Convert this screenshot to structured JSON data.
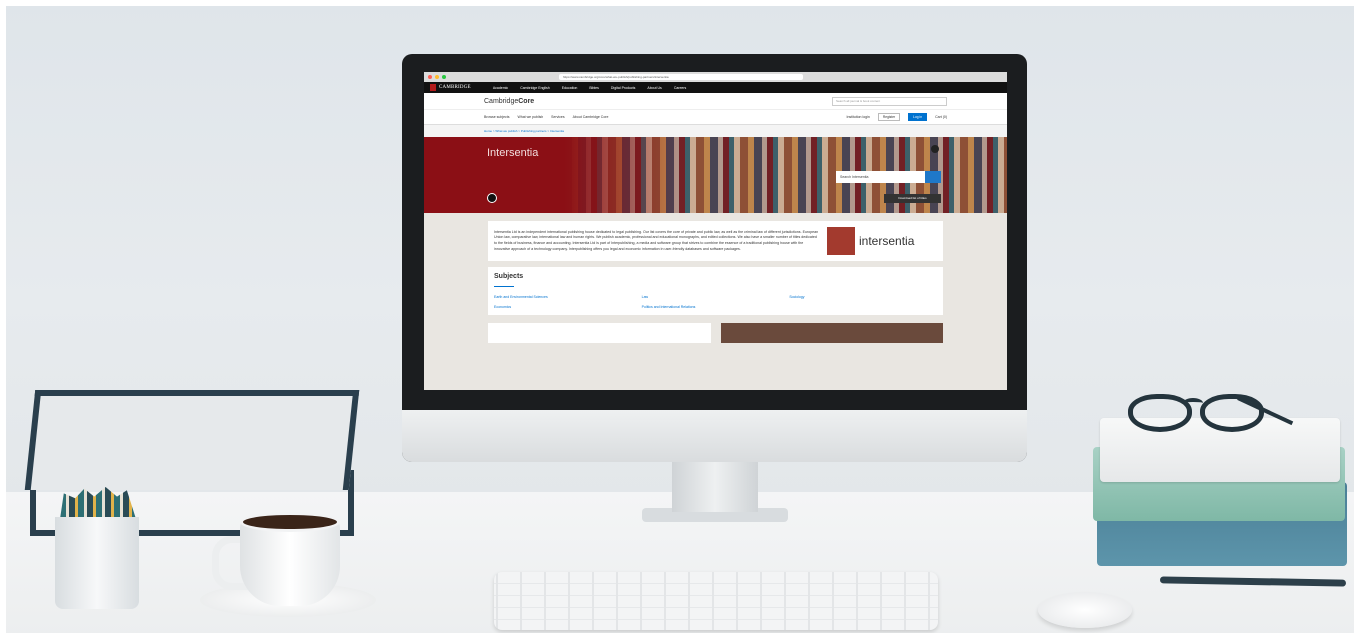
{
  "browser": {
    "url": "https://www.cambridge.org/core/what-we-publish/publishing-partners/intersentia"
  },
  "cup_header": {
    "logo_text": "CAMBRIDGE",
    "logo_sub": "UNIVERSITY PRESS",
    "items": [
      "Academic",
      "Cambridge English",
      "Education",
      "Bibles",
      "Digital Products",
      "About Us",
      "Careers"
    ]
  },
  "core_header": {
    "logo_light": "Cambridge",
    "logo_bold": "Core",
    "search_placeholder": "Search all journal & book content"
  },
  "nav": {
    "items": [
      "Browse subjects",
      "What we publish",
      "Services",
      "About Cambridge Core"
    ],
    "institution_login": "Institution login",
    "register": "Register",
    "login": "Log in",
    "cart": "Cart (0)"
  },
  "breadcrumb": "Home  >  What we publish  >  Publishing partners  >  Intersentia",
  "hero": {
    "title": "Intersentia",
    "search_placeholder": "Search Intersentia",
    "download_label": "Download list of titles"
  },
  "about": {
    "text": "Intersentia Ltd is an independent international publishing house dedicated to legal publishing. Our list covers the core of private and public law, as well as the criminal law of different jurisdictions. European Union law, comparative law, international law and human rights. We publish academic, professional and educational monographs, and edited collections. We also have a smaller number of titles dedicated to the fields of business, finance and accounting. Intersentia Ltd is part of Interpublishing, a media and software group that strives to combine the essence of a traditional publishing house with the innovative approach of a technology company. Interpublishing offers you legal and economic information in user-friendly databases and software packages.",
    "logo_word": "intersentia"
  },
  "subjects": {
    "heading": "Subjects",
    "items": [
      "Earth and Environmental Sciences",
      "Law",
      "Sociology",
      "Economics",
      "Politics and International Relations"
    ]
  },
  "colors": {
    "hero_red": "#8b0f15",
    "link_blue": "#0072cf",
    "cup_black": "#111111"
  }
}
